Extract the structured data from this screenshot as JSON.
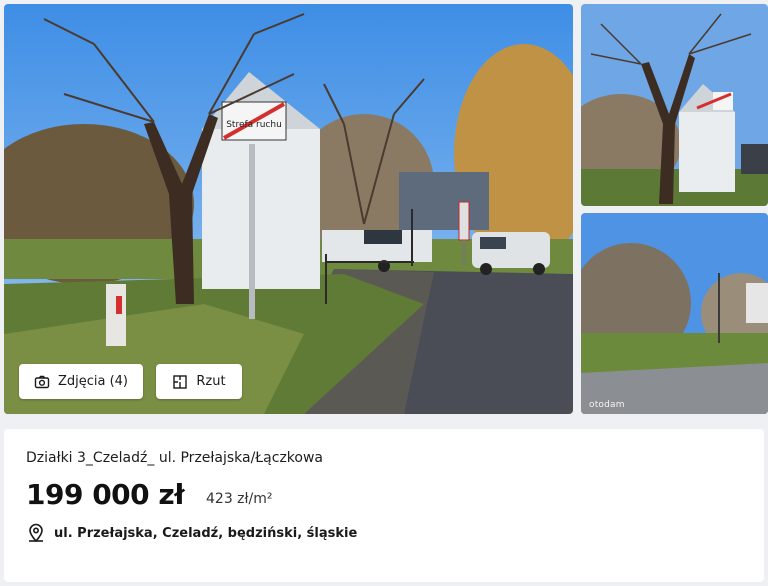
{
  "gallery": {
    "photos_button_label": "Zdjęcia (4)",
    "plan_button_label": "Rzut",
    "watermark": "otodam"
  },
  "photo_sign": {
    "text": "Strefa ruchu"
  },
  "listing": {
    "title": "Działki 3_Czeladź_ ul. Przełajska/Łączkowa",
    "price": "199 000 zł",
    "price_per_m2": "423 zł/m²",
    "address": "ul. Przełajska, Czeladź, będziński, śląskie"
  },
  "icons": {
    "photos": "camera-icon",
    "plan": "floor-plan-icon",
    "address": "map-pin-icon"
  },
  "colors": {
    "page_background": "#eef0f3",
    "card_background": "#ffffff",
    "text": "#111111"
  }
}
